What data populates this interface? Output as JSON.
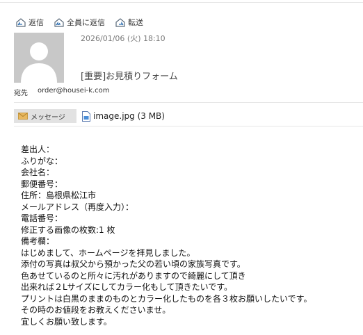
{
  "toolbar": {
    "reply": "返信",
    "reply_all": "全員に返信",
    "forward": "転送"
  },
  "message": {
    "date": "2026/01/06 (火) 18:10",
    "subject": "[重要]お見積りフォーム",
    "to_label": "宛先",
    "to_address": "order@housei-k.com"
  },
  "attachments": {
    "message_tab": "メッセージ",
    "file": "image.jpg (3 MB)"
  },
  "body": {
    "lines": [
      "差出人：",
      "ふりがな：",
      "会社名：",
      "郵便番号：",
      "住所：島根県松江市",
      "メールアドレス（再度入力）：",
      "電話番号：",
      "修正する画像の枚数:1 枚",
      "備考欄：",
      "はじめまして、ホームページを拝見しました。",
      "添付の写真は叔父から預かった父の若い頃の家族写真です。",
      "色あせているのと所々に汚れがありますので綺麗にして頂き",
      "出来れば２Lサイズにしてカラー化もして頂きたいです。",
      "プリントは白黒のままのものとカラー化したものを各３枚お願いしたいです。",
      "その時のお値段をお教えくださいませ。",
      "宜しくお願い致します。"
    ]
  }
}
